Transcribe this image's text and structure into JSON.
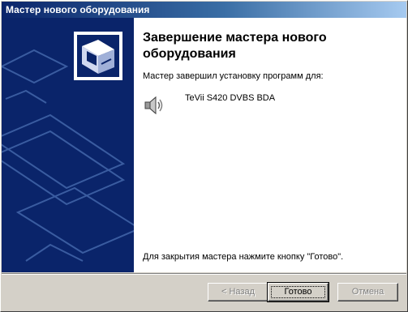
{
  "window": {
    "title": "Мастер нового оборудования"
  },
  "main": {
    "heading": "Завершение мастера нового оборудования",
    "subtext": "Мастер завершил установку программ для:",
    "device": {
      "name": "TeVii S420 DVBS BDA",
      "icon": "speaker-icon"
    },
    "footer_text": "Для закрытия мастера нажмите кнопку \"Готово\"."
  },
  "buttons": {
    "back": "< Назад",
    "finish": "Готово",
    "cancel": "Отмена"
  },
  "colors": {
    "side_panel": "#0a246a",
    "titlebar": "#0a246a"
  }
}
